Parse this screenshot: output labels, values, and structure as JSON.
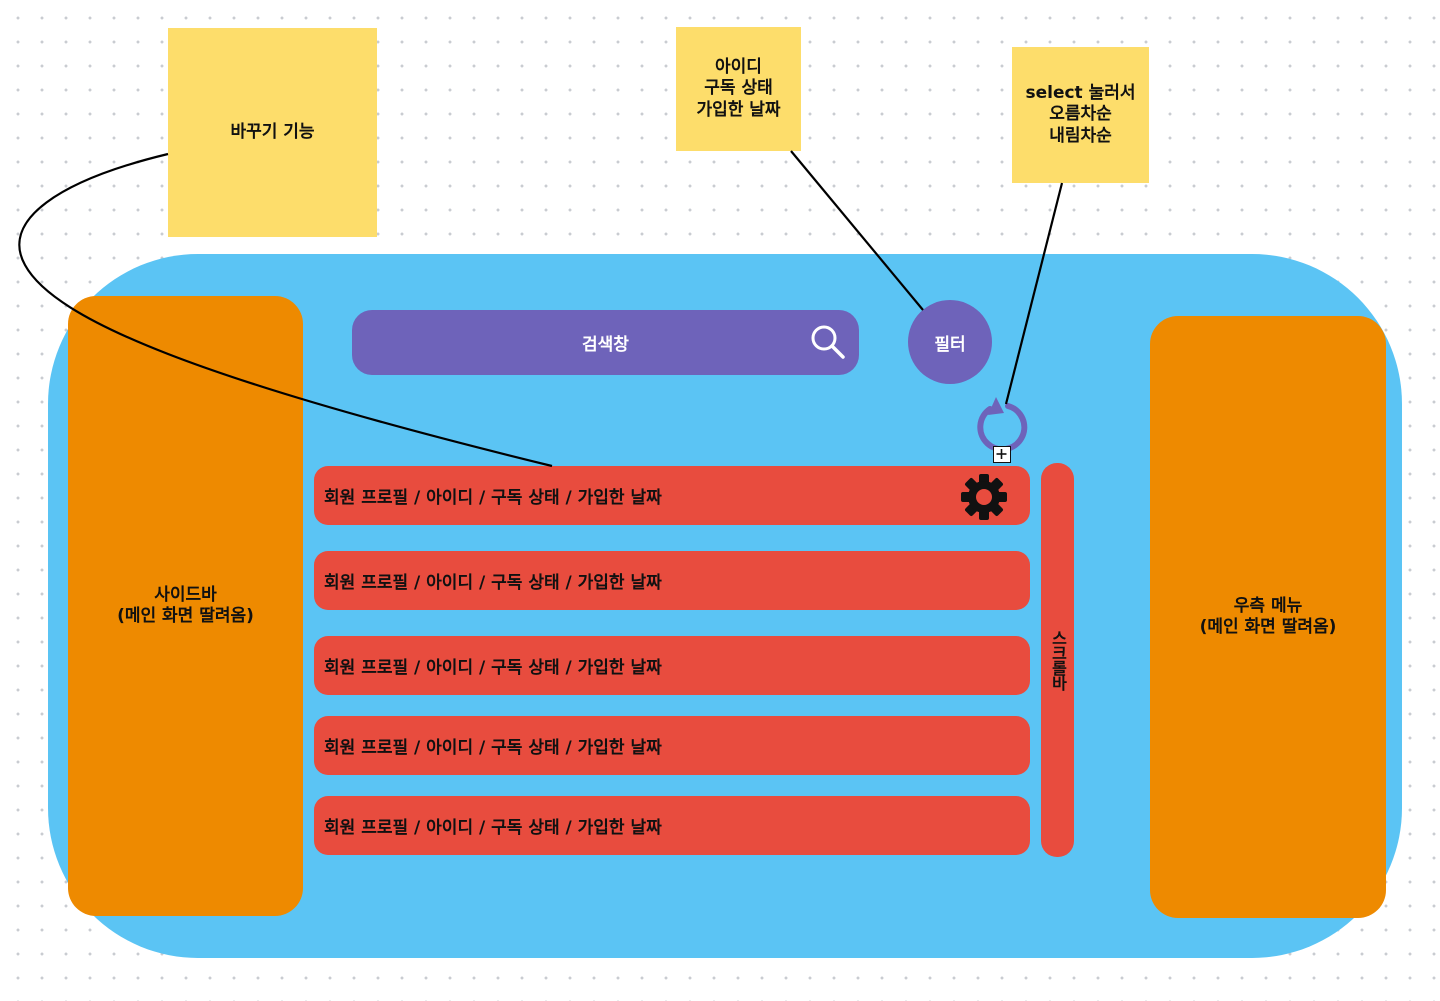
{
  "sidebar": {
    "label": "사이드바\n(메인 화면 딸려옴)"
  },
  "right_menu": {
    "label": "우측 메뉴\n(메인 화면 딸려옴)"
  },
  "search": {
    "label": "검색창",
    "icon": "search-icon"
  },
  "filter": {
    "label": "필터"
  },
  "refresh": {
    "icon": "refresh-icon",
    "badge_icon": "plus-icon"
  },
  "settings": {
    "icon": "gear-icon"
  },
  "member_rows": [
    {
      "label": "회원 프로필 / 아이디 / 구독 상태 / 가입한 날짜"
    },
    {
      "label": "회원 프로필 / 아이디 / 구독 상태 / 가입한 날짜"
    },
    {
      "label": "회원 프로필 / 아이디 / 구독 상태 / 가입한 날짜"
    },
    {
      "label": "회원 프로필 / 아이디 / 구독 상태 / 가입한 날짜"
    },
    {
      "label": "회원 프로필 / 아이디 / 구독 상태 / 가입한 날짜"
    }
  ],
  "scrollbar": {
    "label": "스크롤바"
  },
  "notes": {
    "swap_feature": "바꾸기 기능",
    "filter_fields": "아이디\n구독 상태\n가입한 날짜",
    "sort_select": "select 눌러서\n오름차순\n내림차순"
  },
  "colors": {
    "frame": "#5bc4f4",
    "orange_panel": "#ee8a00",
    "purple": "#6e63ba",
    "row_red": "#e84c3e",
    "sticky_yellow": "#fddd6b"
  }
}
